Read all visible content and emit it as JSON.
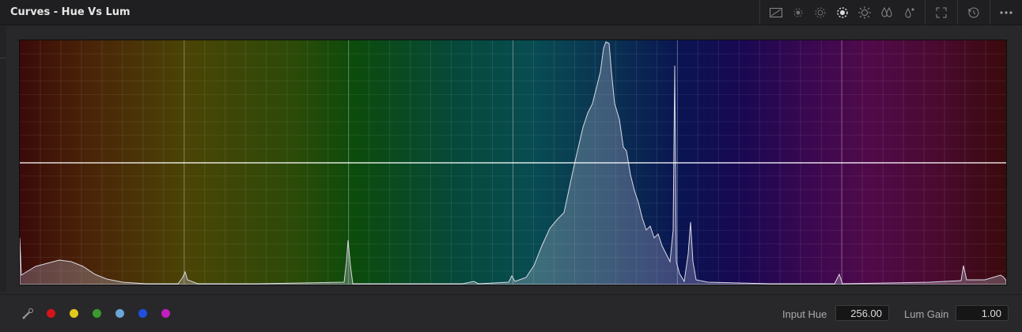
{
  "window": {
    "title": "Curves - Hue Vs Lum"
  },
  "toolbar": {
    "icons": [
      "graph-view-icon",
      "halo-dim-icon",
      "halo-dim-icon",
      "halo-active-icon",
      "sun-icon",
      "droplets-icon",
      "droplet-sun-icon",
      "expand-icon",
      "reset-icon",
      "more-icon"
    ]
  },
  "colors": {
    "swatches": [
      "#d4141c",
      "#e2c91a",
      "#3b9a2e",
      "#6ba6d8",
      "#1f4fe0",
      "#c21fbf"
    ],
    "curve_line": "#ffffff",
    "histogram_stroke": "#d9d9e3"
  },
  "footer": {
    "input_hue_label": "Input Hue",
    "input_hue_value": "256.00",
    "lum_gain_label": "Lum Gain",
    "lum_gain_value": "1.00"
  }
}
